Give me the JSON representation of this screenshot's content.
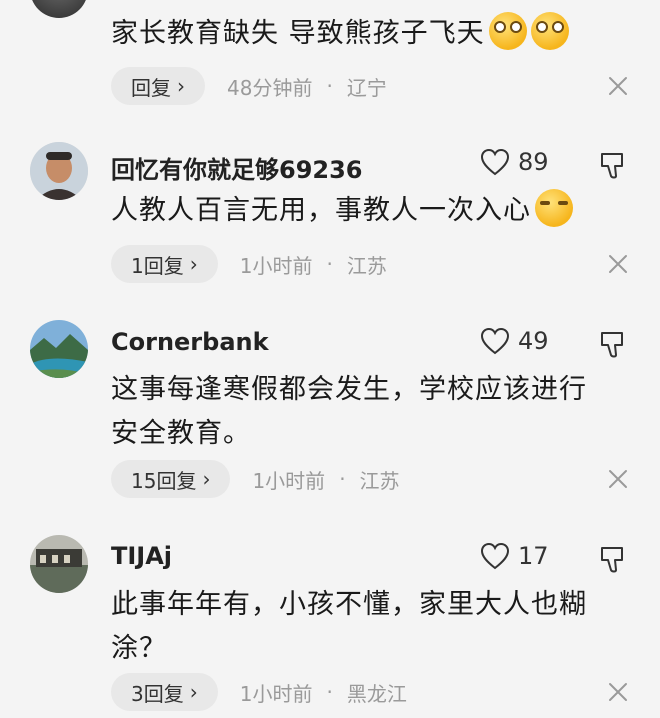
{
  "comments": [
    {
      "username": "",
      "content": "家长教育缺失 导致熊孩子飞天",
      "likes": "",
      "reply_label": "回复",
      "time": "48分钟前",
      "location": "辽宁",
      "emoji": [
        "flushed-hand-over-mouth-emoji",
        "flushed-hand-over-mouth-emoji"
      ]
    },
    {
      "username": "回忆有你就足够69236",
      "content": "人教人百言无用，事教人一次入心",
      "likes": "89",
      "reply_label": "1回复",
      "time": "1小时前",
      "location": "江苏",
      "emoji": [
        "thinking-emoji"
      ]
    },
    {
      "username": "Cornerbank",
      "content_line1": "这事每逢寒假都会发生，学校应该进行",
      "content_line2": "安全教育。",
      "likes": "49",
      "reply_label": "15回复",
      "time": "1小时前",
      "location": "江苏"
    },
    {
      "username": "TIJAj",
      "content_line1": "此事年年有，小孩不懂，家里大人也糊",
      "content_line2": "涂？",
      "likes": "17",
      "reply_label": "3回复",
      "time": "1小时前",
      "location": "黑龙江"
    }
  ],
  "common": {
    "chevron": "›",
    "dot": "·"
  },
  "colors": {
    "background": "#f4f4f4",
    "reply_bg": "#e8e8e8",
    "meta_text": "#9a9a9a"
  }
}
